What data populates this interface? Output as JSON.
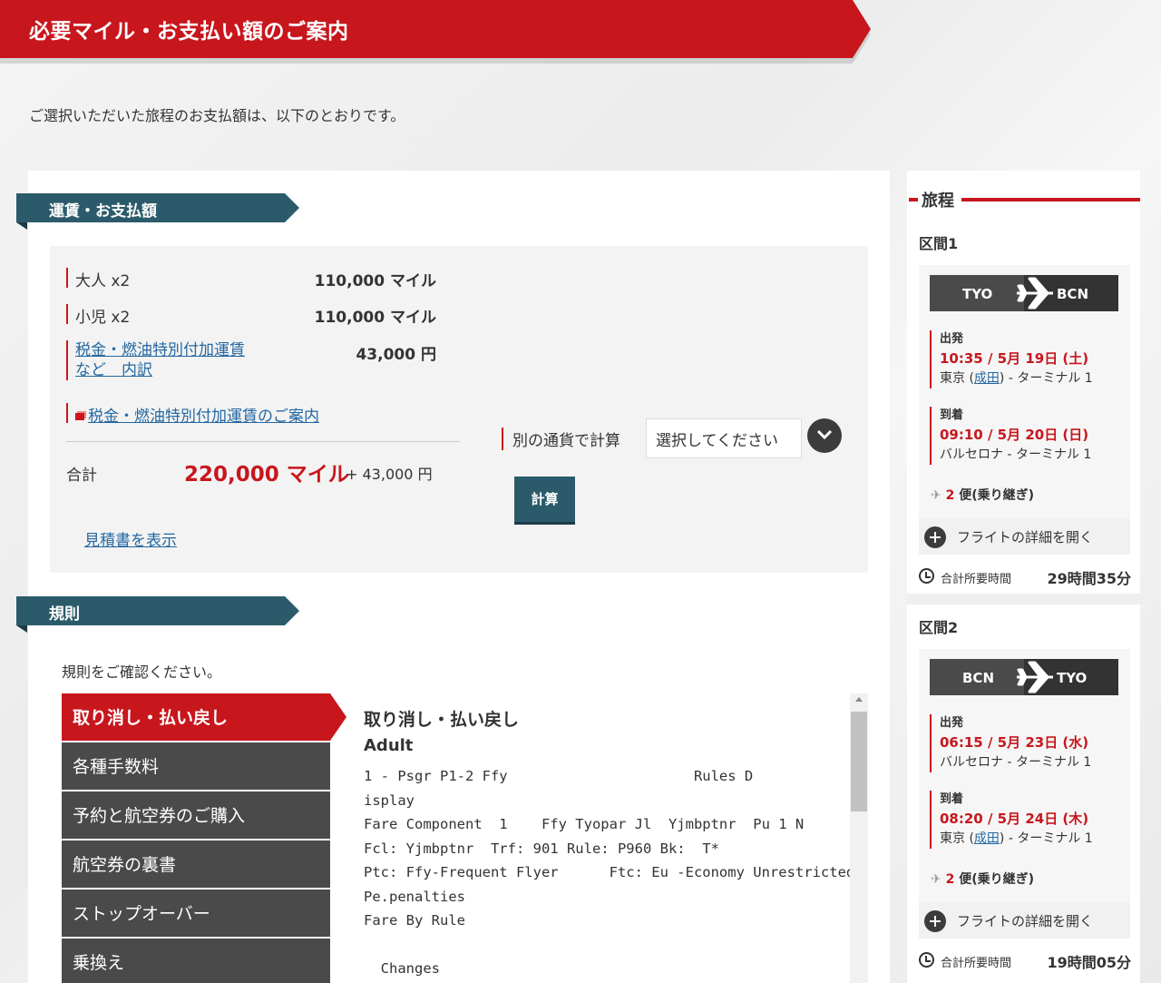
{
  "page": {
    "title": "必要マイル・お支払い額のご案内",
    "intro": "ご選択いただいた旅程のお支払額は、以下のとおりです。"
  },
  "fare": {
    "section_title": "運賃・お支払額",
    "rows": [
      {
        "label": "大人 x2",
        "amount": "110,000 マイル"
      },
      {
        "label": "小児 x2",
        "amount": "110,000 マイル"
      },
      {
        "label_line1": "税金・燃油特別付加運賃",
        "label_line2": "など　内訳",
        "amount": "43,000 円"
      }
    ],
    "surcharge_link": "税金・燃油特別付加運賃のご案内",
    "total_label": "合計",
    "total_miles": "220,000 マイル",
    "total_yen": "+ 43,000 円",
    "estimate_link": "見積書を表示",
    "currency_label": "別の通貨で計算",
    "currency_select": "選択してください",
    "calc_button": "計算"
  },
  "rules": {
    "section_title": "規則",
    "intro": "規則をご確認ください。",
    "menu": [
      "取り消し・払い戻し",
      "各種手数料",
      "予約と航空券のご購入",
      "航空券の裏書",
      "ストップオーバー",
      "乗換え"
    ],
    "active_index": 0,
    "content_title": "取り消し・払い戻し",
    "content_sub": "Adult",
    "content_text": "1 - Psgr P1-2 Ffy                      Rules D\nisplay\nFare Component  1    Ffy Tyopar Jl  Yjmbptnr  Pu 1 N\nFcl: Yjmbptnr  Trf: 901 Rule: P960 Bk:  T*\nPtc: Ffy-Frequent Flyer      Ftc: Eu -Economy Unrestricted\nPe.penalties\nFare By Rule\n\n  Changes"
  },
  "itinerary": {
    "title": "旅程",
    "segments": [
      {
        "label": "区間1",
        "from": "TYO",
        "to": "BCN",
        "depart_label": "出発",
        "depart_time": "10:35 / 5月 19日 (土)",
        "depart_place_pre": "東京 (",
        "depart_place_link": "成田",
        "depart_place_post": ") - ターミナル 1",
        "arrive_label": "到着",
        "arrive_time": "09:10 / 5月 20日 (日)",
        "arrive_place": "バルセロナ - ターミナル 1",
        "flights_count": "2",
        "flights_text": "便(乗り継ぎ)",
        "details_button": "フライトの詳細を開く",
        "duration_label": "合計所要時間",
        "duration": "29時間35分"
      },
      {
        "label": "区間2",
        "from": "BCN",
        "to": "TYO",
        "depart_label": "出発",
        "depart_time": "06:15 / 5月 23日 (水)",
        "depart_place": "バルセロナ - ターミナル 1",
        "arrive_label": "到着",
        "arrive_time": "08:20 / 5月 24日 (木)",
        "arrive_place_pre": "東京 (",
        "arrive_place_link": "成田",
        "arrive_place_post": ") - ターミナル 1",
        "flights_count": "2",
        "flights_text": "便(乗り継ぎ)",
        "details_button": "フライトの詳細を開く",
        "duration_label": "合計所要時間",
        "duration": "19時間05分"
      }
    ]
  },
  "colors": {
    "brand_red": "#c8161d",
    "section_teal": "#2b5b6b",
    "menu_gray": "#4a4a4a"
  }
}
